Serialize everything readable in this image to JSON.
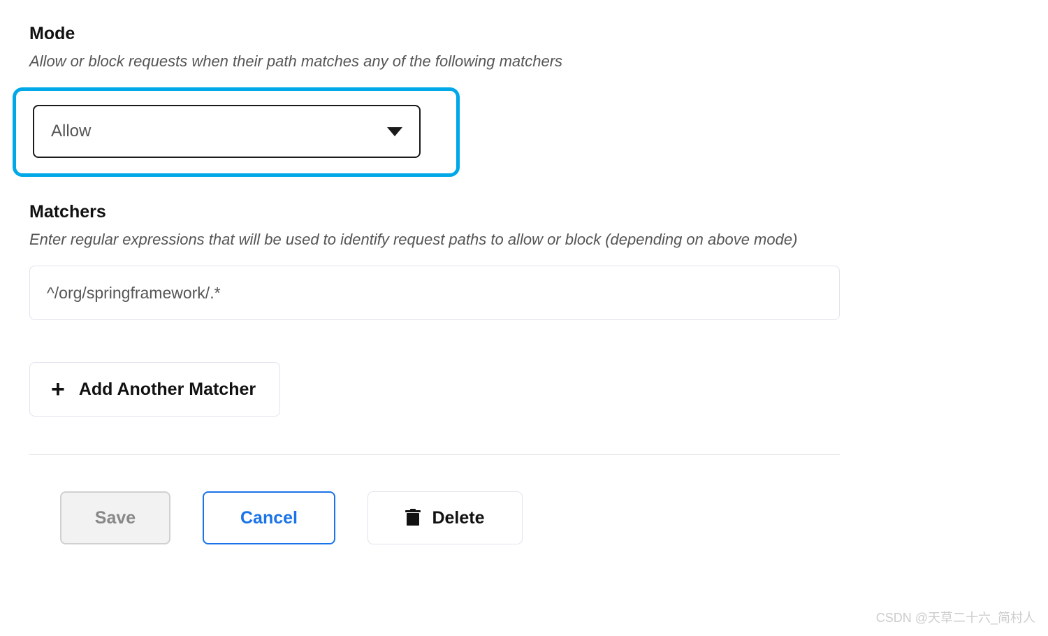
{
  "mode": {
    "label": "Mode",
    "help": "Allow or block requests when their path matches any of the following matchers",
    "selected": "Allow"
  },
  "matchers": {
    "label": "Matchers",
    "help": "Enter regular expressions that will be used to identify request paths to allow or block (depending on above mode)",
    "items": [
      {
        "value": "^/org/springframework/.*"
      }
    ],
    "add_label": "Add Another Matcher"
  },
  "actions": {
    "save": "Save",
    "cancel": "Cancel",
    "delete": "Delete"
  },
  "watermark": "CSDN @天草二十六_简村人"
}
